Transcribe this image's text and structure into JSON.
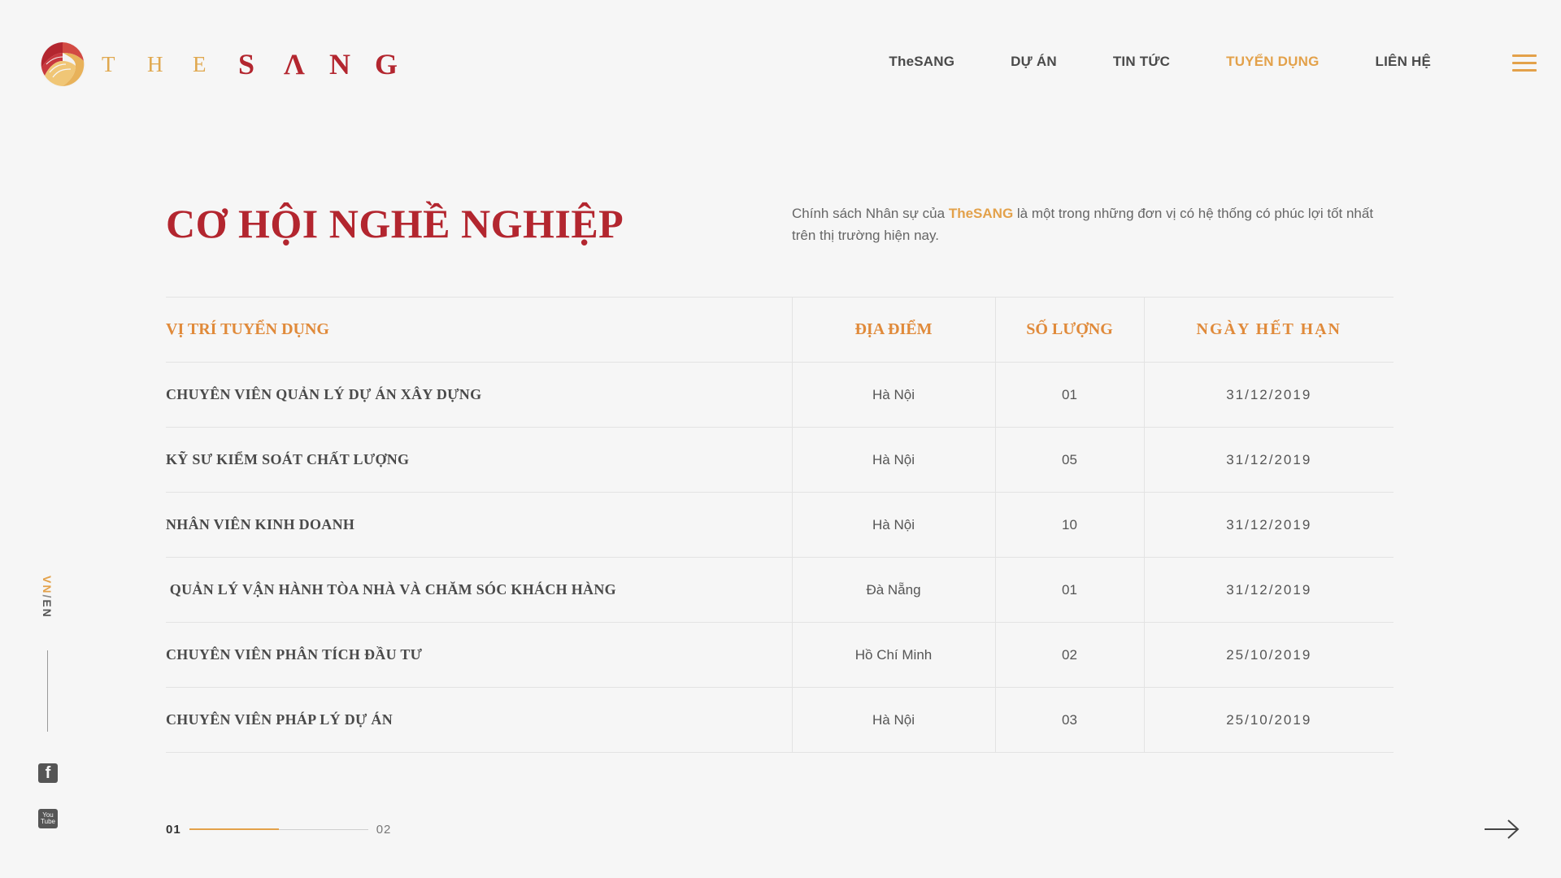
{
  "brand": {
    "logo_the": [
      "T",
      "H",
      "E"
    ],
    "logo_sang": [
      "S",
      "Λ",
      "N",
      "G"
    ]
  },
  "nav": {
    "items": [
      {
        "label": "TheSANG",
        "active": false
      },
      {
        "label": "DỰ ÁN",
        "active": false
      },
      {
        "label": "TIN TỨC",
        "active": false
      },
      {
        "label": "TUYỂN DỤNG",
        "active": true
      },
      {
        "label": "LIÊN HỆ",
        "active": false
      }
    ],
    "menu_icon": "hamburger-icon"
  },
  "sidebar": {
    "lang_vn": "VN",
    "lang_sep": "/",
    "lang_en": "EN",
    "social": [
      {
        "name": "facebook-icon",
        "glyph": "f"
      },
      {
        "name": "youtube-icon",
        "glyph_top": "You",
        "glyph_bottom": "Tube"
      }
    ]
  },
  "main": {
    "title": "CƠ HỘI NGHỀ NGHIỆP",
    "intro_before": "Chính sách Nhân sự của ",
    "intro_brand": "TheSANG",
    "intro_after": " là một trong những đơn vị có hệ thống có phúc lợi tốt nhất trên thị trường hiện nay."
  },
  "table": {
    "headers": {
      "position": "VỊ TRÍ TUYỂN DỤNG",
      "location": "ĐỊA ĐIỂM",
      "quantity": "SỐ LƯỢNG",
      "deadline": "NGÀY HẾT HẠN"
    },
    "rows": [
      {
        "position": "CHUYÊN VIÊN QUẢN LÝ DỰ ÁN XÂY DỰNG",
        "location": "Hà Nội",
        "quantity": "01",
        "deadline": "31/12/2019"
      },
      {
        "position": "KỸ SƯ KIỂM SOÁT CHẤT LƯỢNG",
        "location": "Hà Nội",
        "quantity": "05",
        "deadline": "31/12/2019"
      },
      {
        "position": "NHÂN VIÊN KINH DOANH",
        "location": "Hà Nội",
        "quantity": "10",
        "deadline": "31/12/2019"
      },
      {
        "position": " QUẢN LÝ VẬN HÀNH TÒA NHÀ VÀ CHĂM SÓC KHÁCH HÀNG",
        "location": "Đà Nẵng",
        "quantity": "01",
        "deadline": "31/12/2019"
      },
      {
        "position": "CHUYÊN VIÊN PHÂN TÍCH ĐẦU TƯ",
        "location": "Hồ Chí Minh",
        "quantity": "02",
        "deadline": "25/10/2019"
      },
      {
        "position": "CHUYÊN VIÊN PHÁP LÝ DỰ ÁN",
        "location": "Hà Nội",
        "quantity": "03",
        "deadline": "25/10/2019"
      }
    ]
  },
  "pager": {
    "current": "01",
    "next": "02",
    "progress": 0.5,
    "next_icon": "arrow-right-icon"
  },
  "colors": {
    "brand_red": "#b3262f",
    "accent_gold": "#e3a14a",
    "header_orange": "#e08a3a",
    "background": "#f6f6f6"
  }
}
